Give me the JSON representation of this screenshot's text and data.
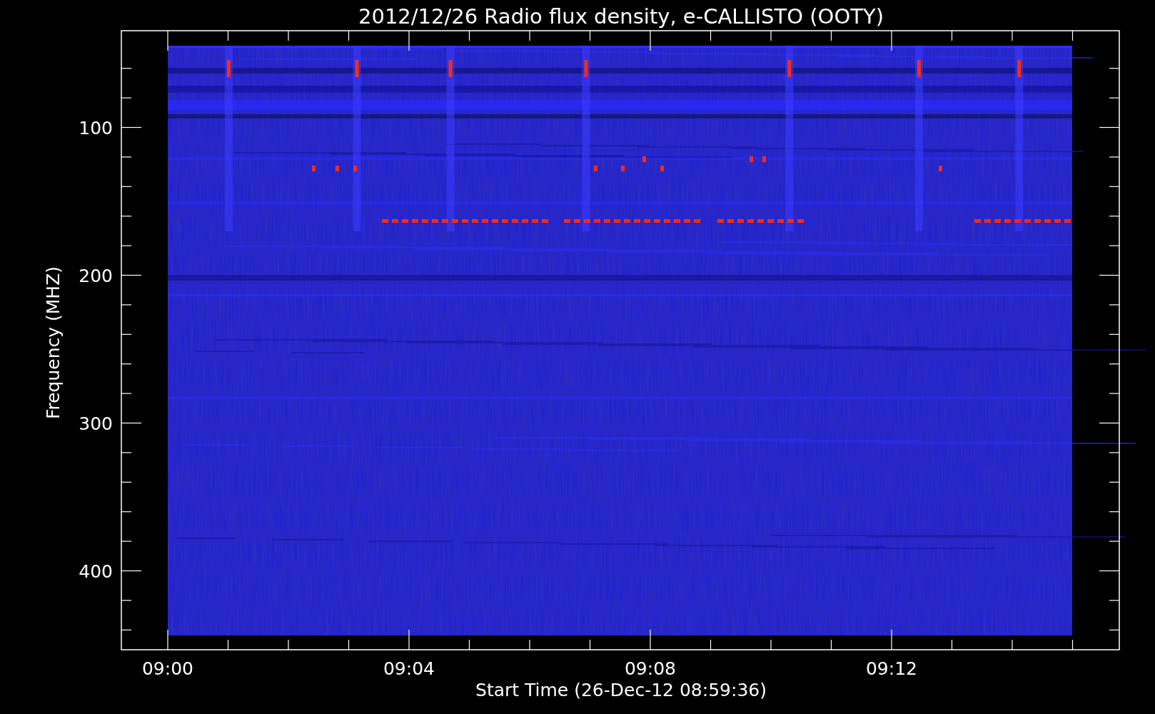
{
  "title": "2012/12/26  Radio flux density, e-CALLISTO (OOTY)",
  "y_axis": {
    "label": "Frequency (MHZ)",
    "ticks": [
      "100",
      "200",
      "300",
      "400"
    ]
  },
  "x_axis": {
    "label": "Start Time (26-Dec-12 08:59:36)",
    "ticks": [
      "09:00",
      "09:04",
      "09:08",
      "09:12"
    ]
  }
}
